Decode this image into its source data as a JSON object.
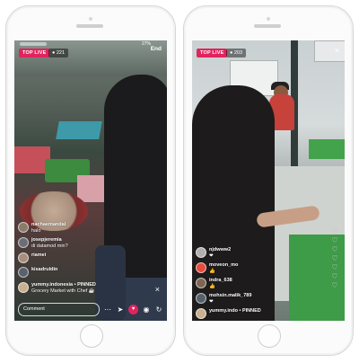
{
  "left_phone": {
    "badge": "TOP LIVE",
    "viewer_count": "221",
    "end_label": "End",
    "status_time": "27%",
    "comments": [
      {
        "user": "nachaemandal",
        "message": "halo"
      },
      {
        "user": "josepjeremia",
        "message": "di datamod min?"
      },
      {
        "user": "riamei",
        "message": ""
      },
      {
        "user": "kisadruldin",
        "message": ""
      }
    ],
    "pinned": {
      "user": "yummy.indonesia",
      "tag": "PINNED",
      "message": "Grocery Market with Chef ☕"
    },
    "input_placeholder": "Comment",
    "icons": [
      "send-icon",
      "heart-icon",
      "camera-icon",
      "switch-icon"
    ]
  },
  "right_phone": {
    "badge": "TOP LIVE",
    "viewer_count": "203",
    "comments": [
      {
        "user": "njdwww2",
        "message": "❤"
      },
      {
        "user": "moveon_mo",
        "message": "👍"
      },
      {
        "user": "indra_638",
        "message": "👍"
      },
      {
        "user": "mohsin.malik_789",
        "message": "❤"
      },
      {
        "user": "yummy.indo",
        "message": "• PINNED"
      }
    ],
    "hearts": [
      "♡",
      "♡",
      "♡",
      "♡",
      "♡",
      "♡",
      "♡"
    ]
  },
  "colors": {
    "live_badge": "#e0245e",
    "accent_green": "#3e9b48"
  }
}
